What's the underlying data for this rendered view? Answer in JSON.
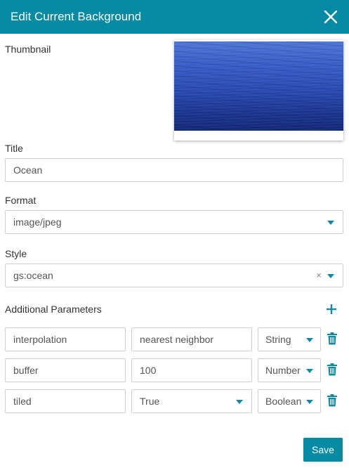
{
  "dialog": {
    "title": "Edit Current Background",
    "header_color": "#078aa3",
    "close_icon": "close-icon"
  },
  "thumbnail": {
    "label": "Thumbnail",
    "image": "ocean-water-photo"
  },
  "title_field": {
    "label": "Title",
    "value": "Ocean"
  },
  "format_field": {
    "label": "Format",
    "value": "image/jpeg"
  },
  "style_field": {
    "label": "Style",
    "value": "gs:ocean",
    "clear_glyph": "×"
  },
  "additional_parameters": {
    "label": "Additional Parameters",
    "add_icon": "plus-icon",
    "rows": [
      {
        "name": "interpolation",
        "value": "nearest neighbor",
        "type": "String"
      },
      {
        "name": "buffer",
        "value": "100",
        "type": "Number"
      },
      {
        "name": "tiled",
        "value": "True",
        "type": "Boolean"
      }
    ]
  },
  "footer": {
    "save_label": "Save"
  }
}
